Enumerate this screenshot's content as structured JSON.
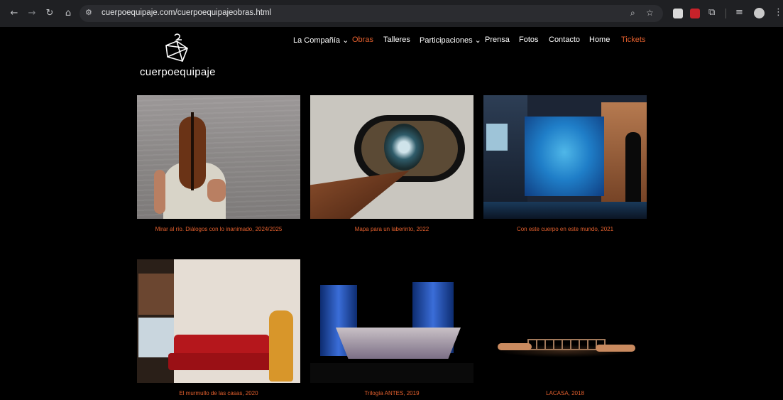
{
  "browser": {
    "url": "cuerpoequipaje.com/cuerpoequipajeobras.html",
    "back_icon": "arrow-left-icon",
    "forward_icon": "arrow-right-icon",
    "reload_icon": "reload-icon",
    "home_icon": "home-icon"
  },
  "site": {
    "brand": "cuerpoequipaje",
    "accent_color": "#e4602e"
  },
  "nav": {
    "items": [
      {
        "label": "La Compañía ⌄"
      },
      {
        "label": "Obras"
      },
      {
        "label": "Talleres"
      },
      {
        "label": "Participaciones ⌄"
      },
      {
        "label": "Prensa"
      },
      {
        "label": "Fotos"
      },
      {
        "label": "Contacto"
      },
      {
        "label": "Home"
      },
      {
        "label": "Tickets"
      }
    ]
  },
  "works": [
    {
      "caption": "Mirar al río. Diálogos con lo inanimado, 2024/2025"
    },
    {
      "caption": "Mapa para un laberinto, 2022"
    },
    {
      "caption": "Con este cuerpo en este mundo, 2021"
    },
    {
      "caption": "El murmullo de las casas, 2020"
    },
    {
      "caption": "Trilogía ANTES, 2019"
    },
    {
      "caption": "LACASA, 2018"
    }
  ]
}
